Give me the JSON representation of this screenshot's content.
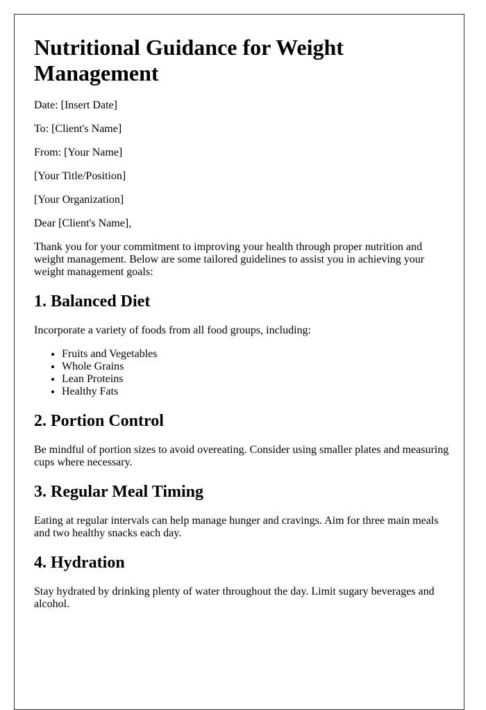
{
  "document": {
    "title": "Nutritional Guidance for Weight Management",
    "header_lines": {
      "date": "Date: [Insert Date]",
      "to": "To: [Client's Name]",
      "from": "From: [Your Name]",
      "title_position": "[Your Title/Position]",
      "organization": "[Your Organization]"
    },
    "salutation": "Dear [Client's Name],",
    "intro": "Thank you for your commitment to improving your health through proper nutrition and weight management. Below are some tailored guidelines to assist you in achieving your weight management goals:",
    "sections": [
      {
        "heading": "1. Balanced Diet",
        "body": "Incorporate a variety of foods from all food groups, including:",
        "list": [
          "Fruits and Vegetables",
          "Whole Grains",
          "Lean Proteins",
          "Healthy Fats"
        ]
      },
      {
        "heading": "2. Portion Control",
        "body": "Be mindful of portion sizes to avoid overeating. Consider using smaller plates and measuring cups where necessary."
      },
      {
        "heading": "3. Regular Meal Timing",
        "body": "Eating at regular intervals can help manage hunger and cravings. Aim for three main meals and two healthy snacks each day."
      },
      {
        "heading": "4. Hydration",
        "body": "Stay hydrated by drinking plenty of water throughout the day. Limit sugary beverages and alcohol."
      }
    ]
  }
}
